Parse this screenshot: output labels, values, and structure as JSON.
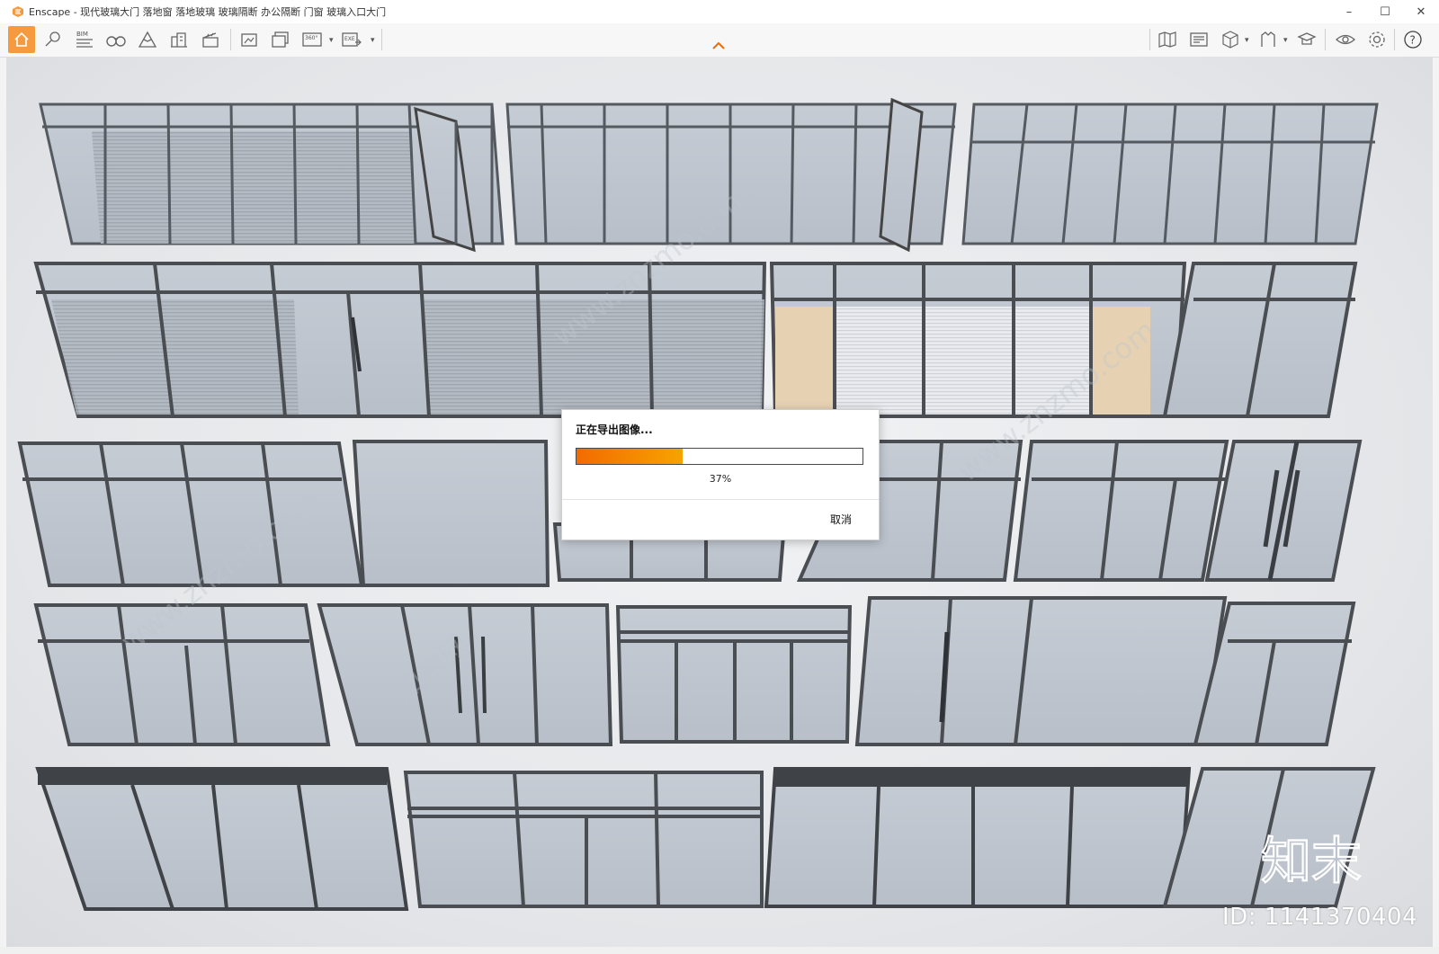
{
  "window": {
    "title": "Enscape - 现代玻璃大门 落地窗 落地玻璃 玻璃隔断 办公隔断 门窗 玻璃入口大门",
    "controls": [
      "–",
      "☐",
      "✕"
    ]
  },
  "toolbar": {
    "left_buttons": [
      "home-icon",
      "pin-icon",
      "bim-icon",
      "binoculars-icon",
      "mountain-icon",
      "buildings-icon",
      "clapper-icon",
      "screenshot-icon",
      "batch-render-icon",
      "panorama-360-icon",
      "exe-export-icon"
    ],
    "right_buttons": [
      "map-icon",
      "asset-library-icon",
      "cube-view-icon",
      "materials-icon",
      "graduation-icon",
      "visibility-icon",
      "settings-icon",
      "help-icon"
    ],
    "bim_label": "BIM",
    "pano_label": "360°",
    "exe_label": "EXE"
  },
  "dialog": {
    "title": "正在导出图像...",
    "progress_percent_text": "37%",
    "progress_value": 0.37,
    "cancel_label": "取消"
  },
  "watermark": {
    "brand": "知末",
    "id_text": "ID: 1141370404",
    "site_text": "www.znzmo.com",
    "cn_text": "知末网"
  },
  "colors": {
    "accent": "#f59a3e",
    "progress_start": "#f26b00",
    "progress_end": "#f7a300",
    "frame": "#4a4d52",
    "glass": "#c9ced6"
  }
}
